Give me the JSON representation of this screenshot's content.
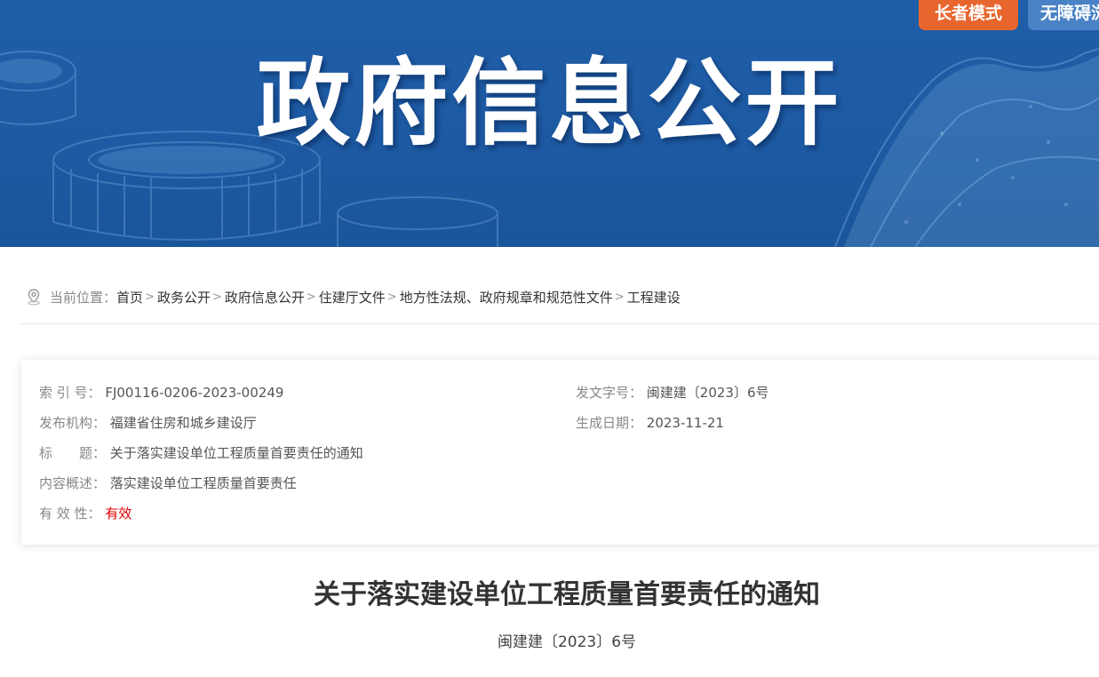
{
  "banner": {
    "title": "政府信息公开",
    "elder_mode_label": "长者模式",
    "accessibility_label": "无障碍浏览"
  },
  "breadcrumb": {
    "prefix": "当前位置：",
    "items": [
      "首页",
      "政务公开",
      "政府信息公开",
      "住建厅文件",
      "地方性法规、政府规章和规范性文件",
      "工程建设"
    ],
    "separator": ">"
  },
  "info": {
    "index_label": "索 引 号：",
    "index_value": "FJ00116-0206-2023-00249",
    "doc_no_label": "发文字号：",
    "doc_no_value": "闽建建〔2023〕6号",
    "publisher_label": "发布机构：",
    "publisher_value": "福建省住房和城乡建设厅",
    "date_label": "生成日期：",
    "date_value": "2023-11-21",
    "title_label": "标　　题：",
    "title_value": "关于落实建设单位工程质量首要责任的通知",
    "summary_label": "内容概述：",
    "summary_value": "落实建设单位工程质量首要责任",
    "validity_label": "有 效 性：",
    "validity_value": "有效"
  },
  "article": {
    "title": "关于落实建设单位工程质量首要责任的通知",
    "doc_number": "闽建建〔2023〕6号"
  },
  "colors": {
    "banner_blue": "#1d5aa3",
    "elder_orange": "#e8662d",
    "access_blue": "#4a82c6",
    "valid_red": "#e00000"
  }
}
